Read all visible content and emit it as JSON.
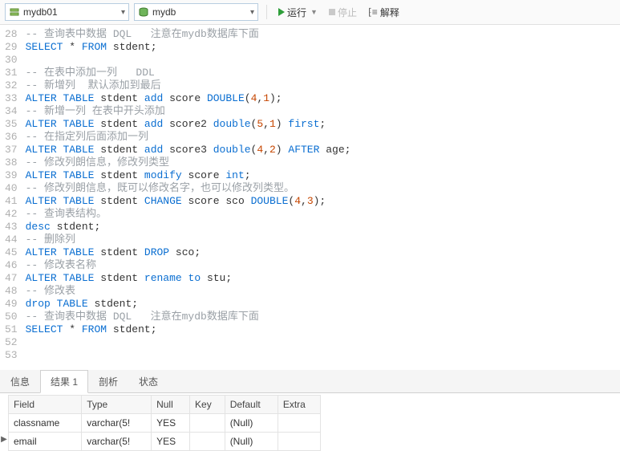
{
  "toolbar": {
    "db_server": "mydb01",
    "db_schema": "mydb",
    "run_label": "运行",
    "stop_label": "停止",
    "explain_label": "解释"
  },
  "code_lines": [
    {
      "n": 28,
      "html": "<span class='tok-com'>-- 查询表中数据 DQL   注意在mydb数据库下面</span>"
    },
    {
      "n": 29,
      "html": "<span class='tok-kw'>SELECT</span> <span class='tok-id'>*</span> <span class='tok-kw'>FROM</span> <span class='tok-id'>stdent;</span>"
    },
    {
      "n": 30,
      "html": ""
    },
    {
      "n": 31,
      "html": "<span class='tok-com'>-- 在表中添加一列   DDL</span>"
    },
    {
      "n": 32,
      "html": "<span class='tok-com'>-- 新增列  默认添加到最后</span>"
    },
    {
      "n": 33,
      "html": "<span class='tok-kw'>ALTER</span> <span class='tok-kw'>TABLE</span> <span class='tok-id'>stdent</span> <span class='tok-kw'>add</span> <span class='tok-id'>score</span> <span class='tok-type'>DOUBLE</span>(<span class='tok-num'>4</span>,<span class='tok-num'>1</span>);"
    },
    {
      "n": 34,
      "html": "<span class='tok-com'>-- 新增一列 在表中开头添加</span>"
    },
    {
      "n": 35,
      "html": "<span class='tok-kw'>ALTER</span> <span class='tok-kw'>TABLE</span> <span class='tok-id'>stdent</span> <span class='tok-kw'>add</span> <span class='tok-id'>score2</span> <span class='tok-type'>double</span>(<span class='tok-num'>5</span>,<span class='tok-num'>1</span>) <span class='tok-kw'>first</span>;"
    },
    {
      "n": 36,
      "html": "<span class='tok-com'>-- 在指定列后面添加一列</span>"
    },
    {
      "n": 37,
      "html": "<span class='tok-kw'>ALTER</span> <span class='tok-kw'>TABLE</span> <span class='tok-id'>stdent</span> <span class='tok-kw'>add</span> <span class='tok-id'>score3</span> <span class='tok-type'>double</span>(<span class='tok-num'>4</span>,<span class='tok-num'>2</span>) <span class='tok-kw'>AFTER</span> <span class='tok-id'>age;</span>"
    },
    {
      "n": 38,
      "html": "<span class='tok-com'>-- 修改列朗信息，修改列类型</span>"
    },
    {
      "n": 39,
      "html": "<span class='tok-kw'>ALTER</span> <span class='tok-kw'>TABLE</span> <span class='tok-id'>stdent</span> <span class='tok-kw'>modify</span> <span class='tok-id'>score</span> <span class='tok-type'>int</span>;"
    },
    {
      "n": 40,
      "html": "<span class='tok-com'>-- 修改列朗信息，既可以修改名字，也可以修改列类型。</span>"
    },
    {
      "n": 41,
      "html": "<span class='tok-kw'>ALTER</span> <span class='tok-kw'>TABLE</span> <span class='tok-id'>stdent</span> <span class='tok-kw'>CHANGE</span> <span class='tok-id'>score</span> <span class='tok-id'>sco</span> <span class='tok-type'>DOUBLE</span>(<span class='tok-num'>4</span>,<span class='tok-num'>3</span>);"
    },
    {
      "n": 42,
      "html": "<span class='tok-com'>-- 查询表结构。</span>"
    },
    {
      "n": 43,
      "html": "<span class='tok-kw'>desc</span> <span class='tok-id'>stdent;</span>"
    },
    {
      "n": 44,
      "html": "<span class='tok-com'>-- 删除列</span>"
    },
    {
      "n": 45,
      "html": "<span class='tok-kw'>ALTER</span> <span class='tok-kw'>TABLE</span> <span class='tok-id'>stdent</span> <span class='tok-kw'>DROP</span> <span class='tok-id'>sco;</span>"
    },
    {
      "n": 46,
      "html": "<span class='tok-com'>-- 修改表名称</span>"
    },
    {
      "n": 47,
      "html": "<span class='tok-kw'>ALTER</span> <span class='tok-kw'>TABLE</span> <span class='tok-id'>stdent</span> <span class='tok-kw'>rename</span> <span class='tok-kw'>to</span> <span class='tok-id'>stu;</span>"
    },
    {
      "n": 48,
      "html": "<span class='tok-com'>-- 修改表</span>"
    },
    {
      "n": 49,
      "html": "<span class='tok-kw'>drop</span> <span class='tok-kw'>TABLE</span> <span class='tok-id'>stdent;</span>"
    },
    {
      "n": 50,
      "html": "<span class='tok-com'>-- 查询表中数据 DQL   注意在mydb数据库下面</span>"
    },
    {
      "n": 51,
      "html": "<span class='tok-kw'>SELECT</span> <span class='tok-id'>*</span> <span class='tok-kw'>FROM</span> <span class='tok-id'>stdent;</span>"
    },
    {
      "n": 52,
      "html": ""
    },
    {
      "n": 53,
      "html": ""
    }
  ],
  "tabs": {
    "info": "信息",
    "result": "结果 1",
    "profile": "剖析",
    "status": "状态"
  },
  "grid": {
    "headers": {
      "field": "Field",
      "type": "Type",
      "null": "Null",
      "key": "Key",
      "default": "Default",
      "extra": "Extra"
    },
    "rows": [
      {
        "field": "classname",
        "type": "varchar(5!",
        "null": "YES",
        "key": "",
        "default": "(Null)",
        "extra": "",
        "current": false
      },
      {
        "field": "email",
        "type": "varchar(5!",
        "null": "YES",
        "key": "",
        "default": "(Null)",
        "extra": "",
        "current": true
      }
    ]
  }
}
